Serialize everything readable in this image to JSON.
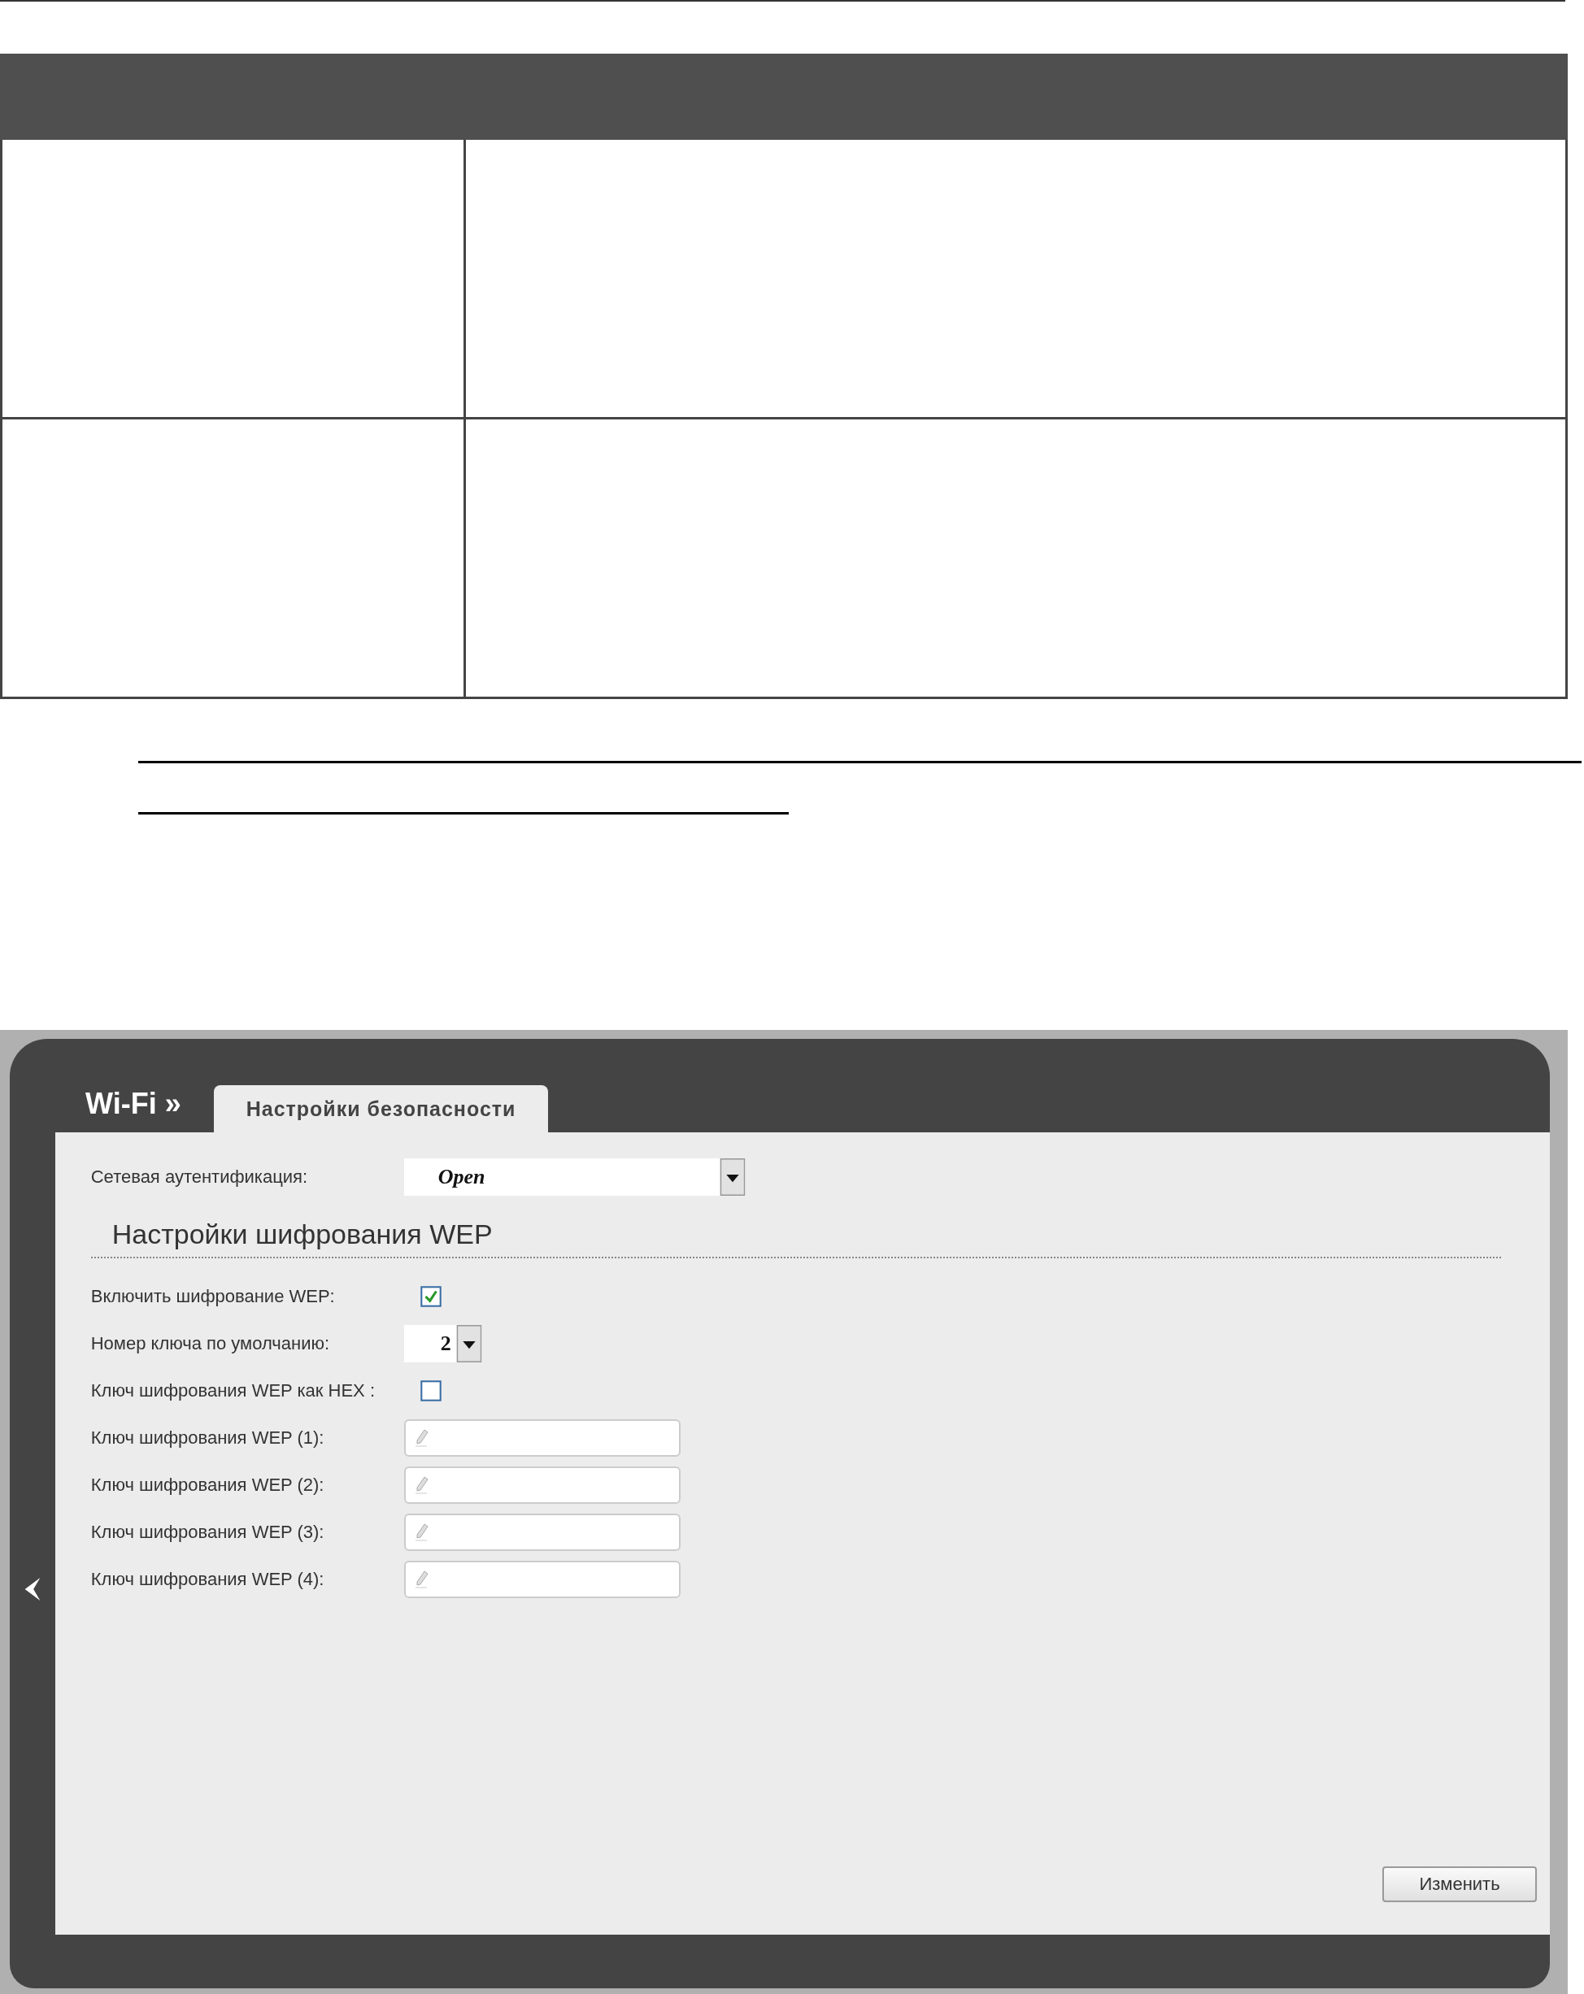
{
  "breadcrumb": "Wi-Fi »",
  "tabs": [
    {
      "label": "Настройки безопасности",
      "selected": true
    }
  ],
  "auth": {
    "label": "Сетевая аутентификация:",
    "value": "Open"
  },
  "section_title": "Настройки шифрования WEP",
  "fields": [
    {
      "kind": "checkbox",
      "label": "Включить шифрование WEP:",
      "checked": true
    },
    {
      "kind": "select",
      "label": "Номер ключа по умолчанию:",
      "value": "2"
    },
    {
      "kind": "checkbox",
      "label": "Ключ шифрования WEP как HEX :",
      "checked": false
    },
    {
      "kind": "text",
      "label": "Ключ шифрования WEP (1):"
    },
    {
      "kind": "text",
      "label": "Ключ шифрования WEP (2):"
    },
    {
      "kind": "text",
      "label": "Ключ шифрования WEP (3):"
    },
    {
      "kind": "text",
      "label": "Ключ шифрования WEP (4):"
    }
  ],
  "apply_button": "Изменить"
}
